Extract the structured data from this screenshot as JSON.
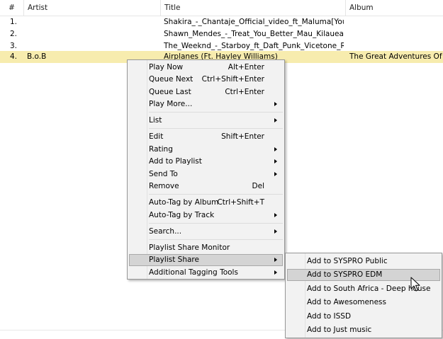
{
  "table": {
    "columns": [
      "#",
      "Artist",
      "Title",
      "Album"
    ],
    "rows": [
      {
        "num": "1.",
        "artist": "",
        "title": "Shakira_-_Chantaje_Official_video_ft_Maluma[Youtu...",
        "album": ""
      },
      {
        "num": "2.",
        "artist": "",
        "title": "Shawn_Mendes_-_Treat_You_Better_Mau_Kilaueas_Tr...",
        "album": ""
      },
      {
        "num": "3.",
        "artist": "",
        "title": "The_Weeknd_-_Starboy_ft_Daft_Punk_Vicetone_Rem...",
        "album": ""
      },
      {
        "num": "4.",
        "artist": "B.o.B",
        "title": "Airplanes (Ft. Hayley Williams)",
        "album": "The Great Adventures Of Bob"
      }
    ]
  },
  "context_menu": {
    "items": [
      {
        "label": "Play Now",
        "shortcut": "Alt+Enter"
      },
      {
        "label": "Queue Next",
        "shortcut": "Ctrl+Shift+Enter"
      },
      {
        "label": "Queue Last",
        "shortcut": "Ctrl+Enter"
      },
      {
        "label": "Play More...",
        "shortcut": ""
      },
      {
        "label": "List",
        "shortcut": ""
      },
      {
        "label": "Edit",
        "shortcut": "Shift+Enter"
      },
      {
        "label": "Rating",
        "shortcut": ""
      },
      {
        "label": "Add to Playlist",
        "shortcut": ""
      },
      {
        "label": "Send To",
        "shortcut": ""
      },
      {
        "label": "Remove",
        "shortcut": "Del"
      },
      {
        "label": "Auto-Tag by Album",
        "shortcut": "Ctrl+Shift+T"
      },
      {
        "label": "Auto-Tag by Track",
        "shortcut": ""
      },
      {
        "label": "Search...",
        "shortcut": ""
      },
      {
        "label": "Playlist Share Monitor",
        "shortcut": ""
      },
      {
        "label": "Playlist Share",
        "shortcut": ""
      },
      {
        "label": "Additional Tagging Tools",
        "shortcut": ""
      }
    ]
  },
  "submenu": {
    "items": [
      {
        "label": "Add to SYSPRO Public"
      },
      {
        "label": "Add to SYSPRO EDM"
      },
      {
        "label": "Add to South Africa - Deep house"
      },
      {
        "label": "Add to Awesomeness"
      },
      {
        "label": "Add to ISSD"
      },
      {
        "label": "Add to Just music"
      }
    ]
  },
  "colors": {
    "selected_row": "#f7ecae",
    "menu_background": "#f2f2f2",
    "menu_highlight": "#d4d4d4"
  },
  "icons": {
    "submenu_arrow": "chevron-right-icon",
    "cursor": "mouse-pointer-icon"
  }
}
